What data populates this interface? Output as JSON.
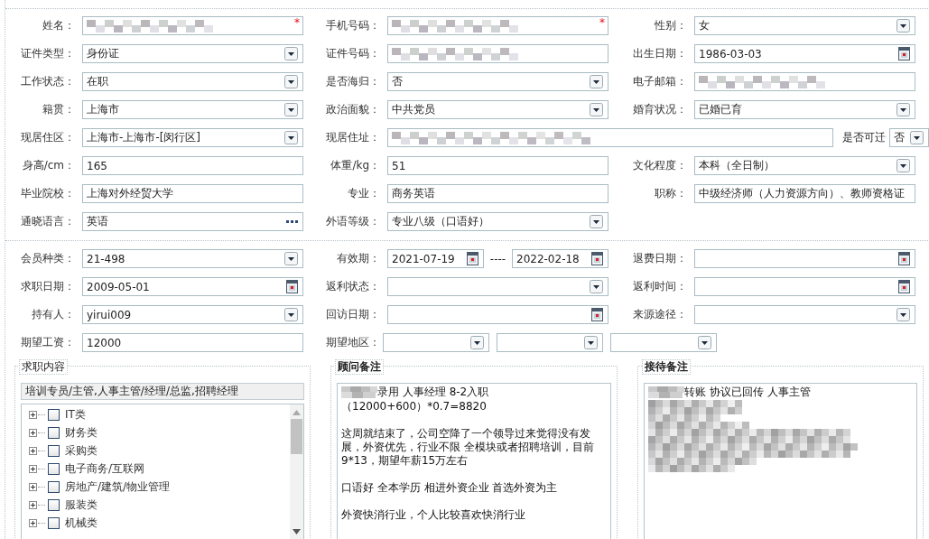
{
  "profile": {
    "rows": [
      [
        {
          "label": "姓名：",
          "kind": "text",
          "redacted": true,
          "marker": "*"
        },
        {
          "label": "手机号码：",
          "kind": "text",
          "redacted": true,
          "marker": "*"
        },
        {
          "label": "性别：",
          "kind": "select",
          "value": "女"
        }
      ],
      [
        {
          "label": "证件类型：",
          "kind": "select",
          "value": "身份证"
        },
        {
          "label": "证件号码：",
          "kind": "text",
          "redacted": true
        },
        {
          "label": "出生日期：",
          "kind": "date",
          "value": "1986-03-03"
        }
      ],
      [
        {
          "label": "工作状态：",
          "kind": "select",
          "value": "在职"
        },
        {
          "label": "是否海归：",
          "kind": "select",
          "value": "否"
        },
        {
          "label": "电子邮箱：",
          "kind": "text",
          "redacted": true
        }
      ],
      [
        {
          "label": "籍贯：",
          "kind": "select",
          "value": "上海市"
        },
        {
          "label": "政治面貌：",
          "kind": "select",
          "value": "中共党员"
        },
        {
          "label": "婚育状况：",
          "kind": "select",
          "value": "已婚已育"
        }
      ],
      [
        {
          "label": "现居住区：",
          "kind": "select",
          "value": " 上海市-上海市-[闵行区]"
        },
        {
          "label": "现居住址：",
          "kind": "text",
          "redacted": true,
          "extra": {
            "label": "是否可迁",
            "kind": "select",
            "value": "否"
          }
        }
      ],
      [
        {
          "label": "身高/cm：",
          "kind": "text",
          "value": "165"
        },
        {
          "label": "体重/kg：",
          "kind": "text",
          "value": "51"
        },
        {
          "label": "文化程度：",
          "kind": "select",
          "value": "本科（全日制）"
        }
      ],
      [
        {
          "label": "毕业院校：",
          "kind": "text",
          "value": "上海对外经贸大学"
        },
        {
          "label": "专业：",
          "kind": "text",
          "value": "商务英语"
        },
        {
          "label": "职称：",
          "kind": "text",
          "value": "中级经济师（人力资源方向）、教师资格证"
        }
      ],
      [
        {
          "label": "通晓语言：",
          "kind": "lookup",
          "value": "英语"
        },
        {
          "label": "外语等级：",
          "kind": "select",
          "value": "专业八级（口语好）"
        }
      ]
    ]
  },
  "membership": {
    "rows": [
      [
        {
          "label": "会员种类：",
          "kind": "select",
          "value": " 21-498"
        },
        {
          "label": "有效期：",
          "kind": "daterange",
          "values": [
            "2021-07-19",
            "2022-02-18"
          ],
          "separator": "----"
        },
        {
          "label": "退费日期：",
          "kind": "date"
        }
      ],
      [
        {
          "label": "求职日期：",
          "kind": "date",
          "value": "2009-05-01"
        },
        {
          "label": "返利状态：",
          "kind": "select"
        },
        {
          "label": "返利时间：",
          "kind": "date"
        }
      ],
      [
        {
          "label": "持有人：",
          "kind": "select",
          "value": "yirui009"
        },
        {
          "label": "回访日期：",
          "kind": "date"
        },
        {
          "label": "来源途径：",
          "kind": "select"
        }
      ],
      [
        {
          "label": "期望工资：",
          "kind": "text",
          "value": "12000"
        },
        {
          "label": "期望地区：",
          "kind": "multiselect",
          "parts": [
            {
              "kind": "select"
            },
            {
              "kind": "select"
            },
            {
              "kind": "select"
            }
          ]
        }
      ]
    ]
  },
  "panels": [
    {
      "kind": "tree",
      "title": "求职内容",
      "summary": "培训专员/主管,人事主管/经理/总监,招聘经理",
      "items": [
        {
          "label": "IT类",
          "expanded": false,
          "checked": false
        },
        {
          "label": "财务类",
          "expanded": false,
          "checked": false
        },
        {
          "label": "采购类",
          "expanded": false,
          "checked": false
        },
        {
          "label": "电子商务/互联网",
          "expanded": false,
          "checked": false
        },
        {
          "label": "房地产/建筑/物业管理",
          "expanded": false,
          "checked": false
        },
        {
          "label": "服装类",
          "expanded": false,
          "checked": false
        },
        {
          "label": "机械类",
          "expanded": false,
          "checked": false
        }
      ]
    },
    {
      "kind": "notes",
      "title": "顾问备注",
      "paragraphs": [
        {
          "redacted_prefix": true,
          "lines": [
            "录用   人事经理  8-2入职",
            "（12000+600）*0.7=8820"
          ]
        },
        {
          "lines": [
            "这周就结束了，公司空降了一个领导过来觉得没有发展，外资优先，行业不限  全模块或者招聘培训，目前9*13，期望年薪15万左右"
          ]
        },
        {
          "lines": [
            "口语好  全本学历  相进外资企业  首选外资为主"
          ]
        },
        {
          "lines": [
            "外资快消行业，个人比较喜欢快消行业"
          ]
        }
      ]
    },
    {
      "kind": "notes",
      "title": "接待备注",
      "paragraphs": [
        {
          "redacted_prefix": true,
          "lines": [
            "转账 协议已回传      人事主管"
          ],
          "redacted_block": true
        }
      ]
    }
  ]
}
